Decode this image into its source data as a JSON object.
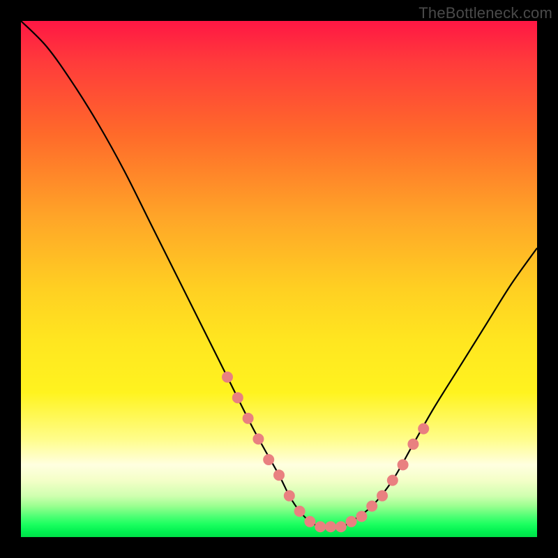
{
  "watermark": "TheBottleneck.com",
  "chart_data": {
    "type": "line",
    "title": "",
    "xlabel": "",
    "ylabel": "",
    "xlim": [
      0,
      100
    ],
    "ylim": [
      0,
      100
    ],
    "grid": false,
    "legend": false,
    "series": [
      {
        "name": "bottleneck-curve",
        "color": "#000000",
        "x": [
          0,
          5,
          10,
          15,
          20,
          25,
          30,
          35,
          40,
          45,
          50,
          52,
          54,
          56,
          58,
          60,
          62,
          64,
          68,
          72,
          76,
          80,
          85,
          90,
          95,
          100
        ],
        "y": [
          100,
          95,
          88,
          80,
          71,
          61,
          51,
          41,
          31,
          21,
          12,
          8,
          5,
          3,
          2,
          2,
          2,
          3,
          6,
          11,
          18,
          25,
          33,
          41,
          49,
          56
        ]
      }
    ],
    "markers": {
      "name": "highlight-dots",
      "color": "#e98080",
      "radius_px": 8,
      "x": [
        40,
        42,
        44,
        46,
        48,
        50,
        52,
        54,
        56,
        58,
        60,
        62,
        64,
        66,
        68,
        70,
        72,
        74,
        76,
        78
      ],
      "y": [
        31,
        27,
        23,
        19,
        15,
        12,
        8,
        5,
        3,
        2,
        2,
        2,
        3,
        4,
        6,
        8,
        11,
        14,
        18,
        21
      ]
    },
    "background": {
      "type": "vertical-gradient",
      "description": "red (top) → orange → yellow → pale → green (bottom), value represents bottleneck severity"
    }
  }
}
